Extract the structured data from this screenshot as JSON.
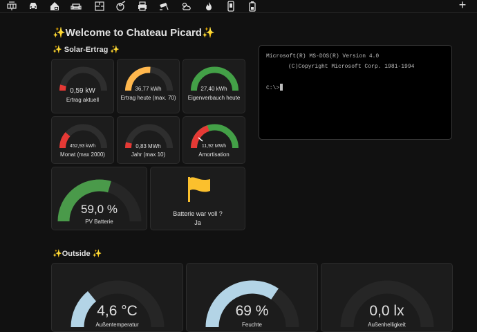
{
  "nav": {
    "icons": [
      "solar-panel-icon",
      "car-icon",
      "home-lock-icon",
      "sofa-icon",
      "floorplan-icon",
      "robot-vacuum-icon",
      "printer-icon",
      "cctv-icon",
      "weather-icon",
      "fire-icon",
      "phone-icon",
      "battery-icon"
    ],
    "add_label": "+"
  },
  "page": {
    "title": "✨Welcome to Chateau Picard✨"
  },
  "solar": {
    "title": "✨ Solar-Ertrag ✨",
    "tiles": [
      {
        "value": "0,59 kW",
        "label": "Ertrag aktuell",
        "fraction": 0.08,
        "color": "#e53935"
      },
      {
        "value": "36,77 kWh",
        "label": "Ertrag heute (max. 70)",
        "fraction": 0.52,
        "color": "#ffb74d"
      },
      {
        "value": "27,40 kWh",
        "label": "Eigenverbauch heute",
        "fraction": 1.0,
        "color": "#43a047"
      },
      {
        "value": "452,93 kWh",
        "label": "Monat (max 2000)",
        "fraction": 0.23,
        "color": "#e53935"
      },
      {
        "value": "0,83 MWh",
        "label": "Jahr (max 10)",
        "fraction": 0.08,
        "color": "#e53935"
      },
      {
        "value": "11,92 MWh",
        "label": "Amortisation",
        "fraction": 0.4,
        "color": "#e53935"
      }
    ]
  },
  "battery": {
    "gauge": {
      "value": "59,0 %",
      "label": "PV Batterie",
      "fraction": 0.59,
      "color": "#4a9a4a"
    },
    "status": {
      "title": "Batterie war voll ?",
      "value": "Ja",
      "icon_color": "#fbc02d"
    }
  },
  "terminal": {
    "line1": "Microsoft(R) MS-DOS(R) Version 4.0",
    "line2": "(C)Copyright Microsoft Corp. 1981-1994",
    "prompt": "C:\\>"
  },
  "outside": {
    "title": "✨Outside ✨",
    "tiles": [
      {
        "value": "4,6 °C",
        "label": "Außentemperatur",
        "fraction": 0.28,
        "color": "#b3d4e6"
      },
      {
        "value": "69 %",
        "label": "Feuchte",
        "fraction": 0.69,
        "color": "#b3d4e6"
      },
      {
        "value": "0,0 lx",
        "label": "Außenhelligkeit",
        "fraction": 0.0,
        "color": "#b3d4e6"
      }
    ]
  }
}
